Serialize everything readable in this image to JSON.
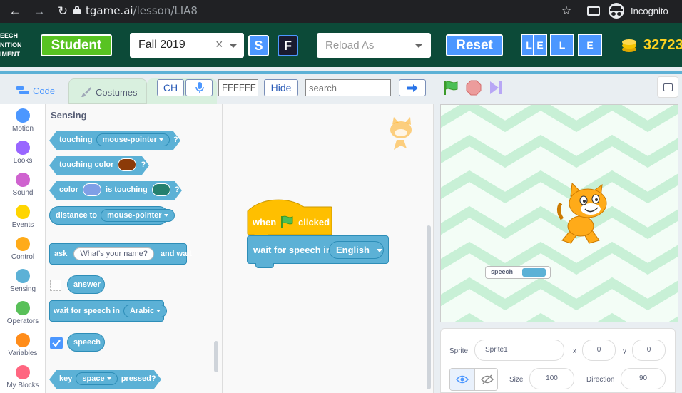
{
  "browser": {
    "url_host": "tgame.ai",
    "url_path": "/lesson/LIA8",
    "incognito_label": "Incognito"
  },
  "header": {
    "brand_lines": [
      "EECH",
      "NITION",
      "IMENT"
    ],
    "student_label": "Student",
    "term_value": "Fall 2019",
    "clear_glyph": "×",
    "s_label": "S",
    "f_label": "F",
    "reload_placeholder": "Reload As",
    "reset_label": "Reset",
    "tiles": [
      "L",
      "E",
      "L",
      "E"
    ],
    "coins": "32723"
  },
  "tabs": {
    "code": "Code",
    "costumes": "Costumes"
  },
  "toolbar": {
    "ch_label": "CH",
    "color_value": "FFFFFF",
    "hide_label": "Hide",
    "search_placeholder": "search"
  },
  "categories": [
    {
      "label": "Motion",
      "color": "#4c97ff"
    },
    {
      "label": "Looks",
      "color": "#9966ff"
    },
    {
      "label": "Sound",
      "color": "#cf63cf"
    },
    {
      "label": "Events",
      "color": "#ffd500"
    },
    {
      "label": "Control",
      "color": "#ffab19"
    },
    {
      "label": "Sensing",
      "color": "#5cb1d6"
    },
    {
      "label": "Operators",
      "color": "#59c059"
    },
    {
      "label": "Variables",
      "color": "#ff8c1a"
    },
    {
      "label": "My Blocks",
      "color": "#ff6680"
    }
  ],
  "palette": {
    "heading": "Sensing",
    "touching": "touching",
    "mouse_pointer": "mouse-pointer",
    "touching_color": "touching color",
    "color": "color",
    "is_touching": "is touching",
    "distance_to": "distance to",
    "ask": "ask",
    "ask_default": "What's your name?",
    "and_wait": "and wait",
    "answer": "answer",
    "wait_for_speech_in": "wait for speech in",
    "arabic": "Arabic",
    "speech": "speech",
    "key": "key",
    "space": "space",
    "pressed": "pressed?",
    "question_mark": "?",
    "swatch_colors": [
      "#8b3a08",
      "#7f9fe6",
      "#25806f"
    ]
  },
  "script": {
    "when": "when",
    "clicked": "clicked",
    "wait_for_speech_in": "wait for speech in",
    "language": "English"
  },
  "stage": {
    "speech_label": "speech"
  },
  "sprite_info": {
    "sprite_label": "Sprite",
    "sprite_name": "Sprite1",
    "x_label": "x",
    "x_value": "0",
    "y_label": "y",
    "y_value": "0",
    "size_label": "Size",
    "size_value": "100",
    "direction_label": "Direction",
    "direction_value": "90"
  },
  "colors": {
    "header_bg": "#0c4a38",
    "sensing": "#5cb1d6",
    "events": "#ffbf00",
    "accent": "#4c97ff"
  }
}
